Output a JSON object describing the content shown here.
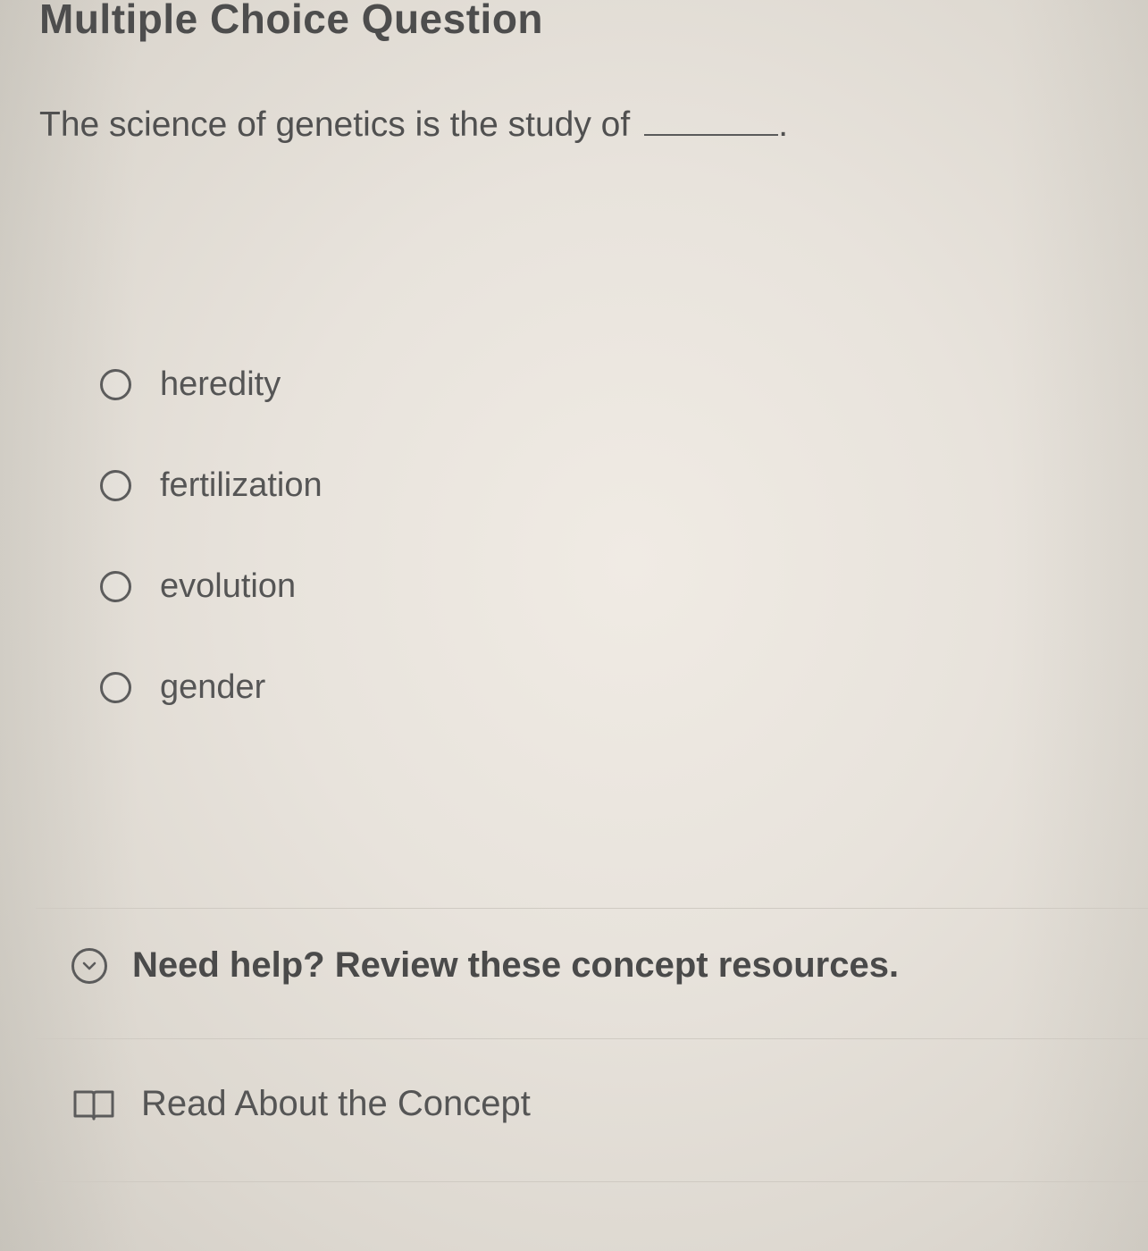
{
  "header": {
    "title": "Multiple Choice Question"
  },
  "question": {
    "text": "The science of genetics is the study of",
    "blank_suffix": "."
  },
  "options": [
    {
      "label": "heredity"
    },
    {
      "label": "fertilization"
    },
    {
      "label": "evolution"
    },
    {
      "label": "gender"
    }
  ],
  "help": {
    "label": "Need help? Review these concept resources.",
    "icon": "chevron-down-circle-icon"
  },
  "resources": {
    "read_label": "Read About the Concept",
    "icon": "book-icon"
  }
}
